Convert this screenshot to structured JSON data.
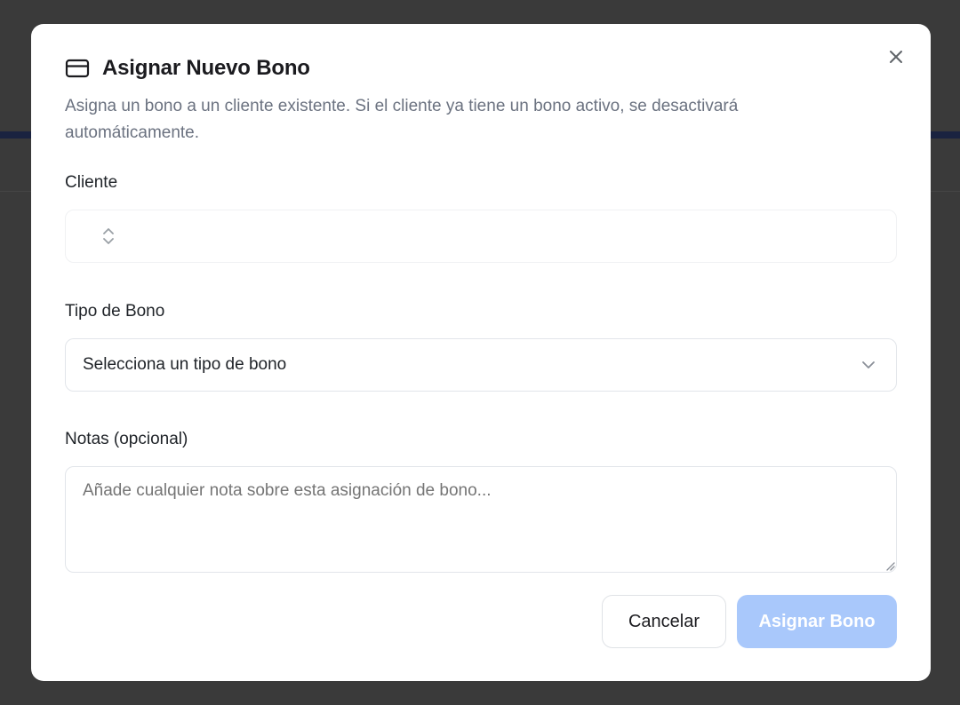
{
  "dialog": {
    "title": "Asignar Nuevo Bono",
    "description": "Asigna un bono a un cliente existente. Si el cliente ya tiene un bono activo, se desactivará automáticamente.",
    "title_icon": "credit-card-icon",
    "close_icon": "close-icon"
  },
  "form": {
    "cliente": {
      "label": "Cliente",
      "value": "",
      "icon": "chevrons-up-down-icon"
    },
    "tipo_bono": {
      "label": "Tipo de Bono",
      "selected": "Selecciona un tipo de bono",
      "icon": "chevron-down-icon"
    },
    "notas": {
      "label": "Notas (opcional)",
      "value": "",
      "placeholder": "Añade cualquier nota sobre esta asignación de bono..."
    }
  },
  "actions": {
    "cancel_label": "Cancelar",
    "submit_label": "Asignar Bono",
    "submit_color": "#a9c8fb"
  }
}
